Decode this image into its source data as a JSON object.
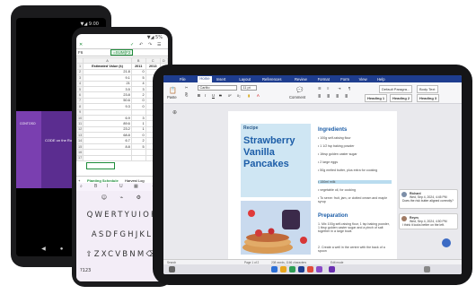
{
  "phone1": {
    "status": "▼◢ 9:00",
    "slide_logo": "CONTOSO",
    "slide_title": "CODE on the Rocks"
  },
  "phone2": {
    "status": "▼◢ 5%",
    "cell_ref": "F6",
    "formula": "=SUM(F2",
    "columns": [
      "",
      "A",
      "B",
      "C",
      "D"
    ],
    "header_row": [
      "1",
      "Estimated Value (k)",
      "2011",
      "2013",
      ""
    ],
    "rows": [
      [
        "2",
        "21.8",
        "0",
        "5"
      ],
      [
        "3",
        "9.1",
        "5",
        "0"
      ],
      [
        "4",
        "21",
        "4",
        "2"
      ],
      [
        "5",
        "3.5",
        "3",
        "0"
      ],
      [
        "6",
        "23.8",
        "2",
        "4"
      ],
      [
        "7",
        "50.6",
        "0",
        "5"
      ],
      [
        "8",
        "9.3",
        "0",
        "2"
      ],
      [
        "9",
        "",
        "",
        ""
      ],
      [
        "10",
        "6.9",
        "3",
        "1"
      ],
      [
        "11",
        "89.6",
        "1",
        "0"
      ],
      [
        "12",
        "23.2",
        "1",
        "2"
      ],
      [
        "13",
        "68.8",
        "0",
        "4"
      ],
      [
        "14",
        "6.7",
        "2",
        "3"
      ],
      [
        "15",
        "8.8",
        "5",
        "1"
      ],
      [
        "16",
        "",
        "",
        ""
      ],
      [
        "17",
        "",
        "",
        ""
      ]
    ],
    "sheet_tab_1": "Planting Schedule",
    "sheet_tab_2": "Harvest Log",
    "kb_row1": "QWERTYUIOP",
    "kb_row2": "ASDFGHJKL",
    "kb_row3": "ZXCVBNM",
    "kb_key": "?123"
  },
  "tablet": {
    "menu": [
      "File",
      "Home",
      "Insert",
      "Layout",
      "References",
      "Review",
      "Format",
      "Form",
      "View",
      "Help"
    ],
    "active_menu": "Home",
    "paste_label": "Paste",
    "font_name": "Carlito",
    "font_size": "11 pt",
    "comment_btn": "Comment",
    "styles": [
      "Default Paragra...",
      "Body Text",
      "Heading 1",
      "Heading 2",
      "Heading 3"
    ],
    "recipe_label": "Recipe",
    "title_lines": [
      "Strawberry",
      "Vanilla",
      "Pancakes"
    ],
    "ingredients_head": "Ingredients",
    "ingredients": [
      "• 100g self-raising flour",
      "• 1 1/2 tsp baking powder",
      "• 1tbsp golden caster sugar",
      "• 2 large eggs",
      "• 50g melted butter, plus extra for cooking",
      "• 150ml milk",
      "• vegetable oil, for cooking",
      "• To serve: fruit, jam, or clotted cream and maple syrup"
    ],
    "highlight_index": 5,
    "prep_head": "Preparation",
    "prep": [
      "1. Mix 100g self-raising flour, 1 tsp baking powder, 1 tbsp golden caster sugar and a pinch of salt together in a large bowl.",
      "2. Create a well in the centre with the back of a spoon"
    ],
    "comments": [
      {
        "author": "Richard",
        "date": "Wed, Sep 4, 2024, 4:45 PM",
        "text": "Does the risk butter aligned correctly?"
      },
      {
        "author": "Reyes",
        "date": "Wed, Sep 4, 2024, 4:50 PM",
        "text": "I think it looks better on the left."
      }
    ],
    "status": [
      "Page 1 of 2",
      "208 words, 1166 characters",
      "Edit mode"
    ],
    "colors": {
      "menubar": "#1e3d8f",
      "title": "#1d5ea8",
      "band": "#cfe6f3"
    }
  }
}
